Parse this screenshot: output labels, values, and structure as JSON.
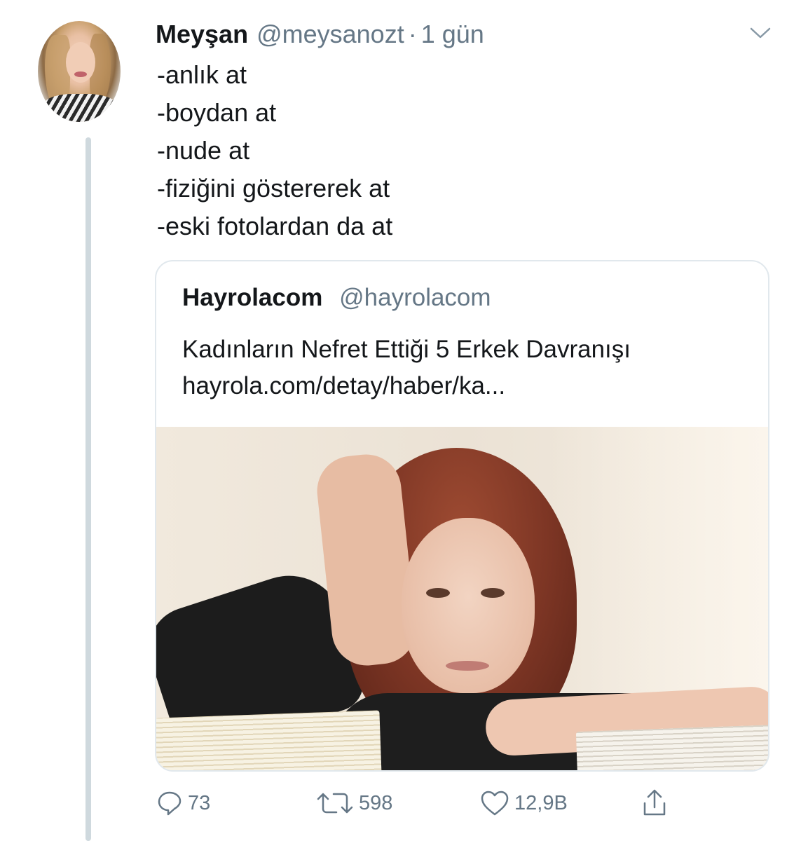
{
  "tweet": {
    "display_name": "Meyşan",
    "handle": "@meysanozt",
    "separator": "·",
    "time": "1 gün",
    "lines": [
      "-anlık at",
      "-boydan at",
      "-nude at",
      "-fiziğini göstererek at",
      "-eski fotolardan da at"
    ]
  },
  "quote": {
    "display_name": "Hayrolacom",
    "handle": "@hayrolacom",
    "title": "Kadınların Nefret Ettiği 5 Erkek Davranışı",
    "link": "hayrola.com/detay/haber/ka..."
  },
  "actions": {
    "reply_count": "73",
    "retweet_count": "598",
    "like_count": "12,9B"
  },
  "icons": {
    "caret": "chevron-down-icon",
    "reply": "reply-icon",
    "retweet": "retweet-icon",
    "like": "heart-icon",
    "share": "share-icon"
  },
  "colors": {
    "text": "#14171a",
    "secondary": "#657786",
    "border": "#e1e8ed",
    "thread_line": "#cfd9de"
  }
}
